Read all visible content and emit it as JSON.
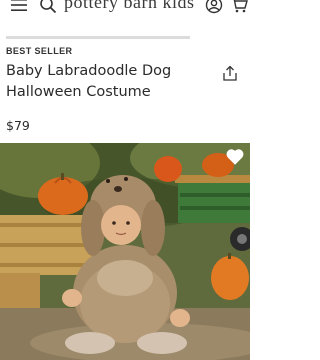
{
  "header": {
    "brand": "pottery barn kids",
    "icons": [
      "menu-icon",
      "search-icon",
      "account-icon",
      "cart-icon"
    ]
  },
  "product": {
    "badge": "BEST SELLER",
    "title": "Baby Labradoodle Dog Halloween Costume",
    "price": "$79",
    "share_icon": "share-icon",
    "favorite_icon": "heart-icon"
  },
  "colors": {
    "background": "#ffffff",
    "text": "#2b2b2b",
    "divider": "#dcdcdc"
  }
}
